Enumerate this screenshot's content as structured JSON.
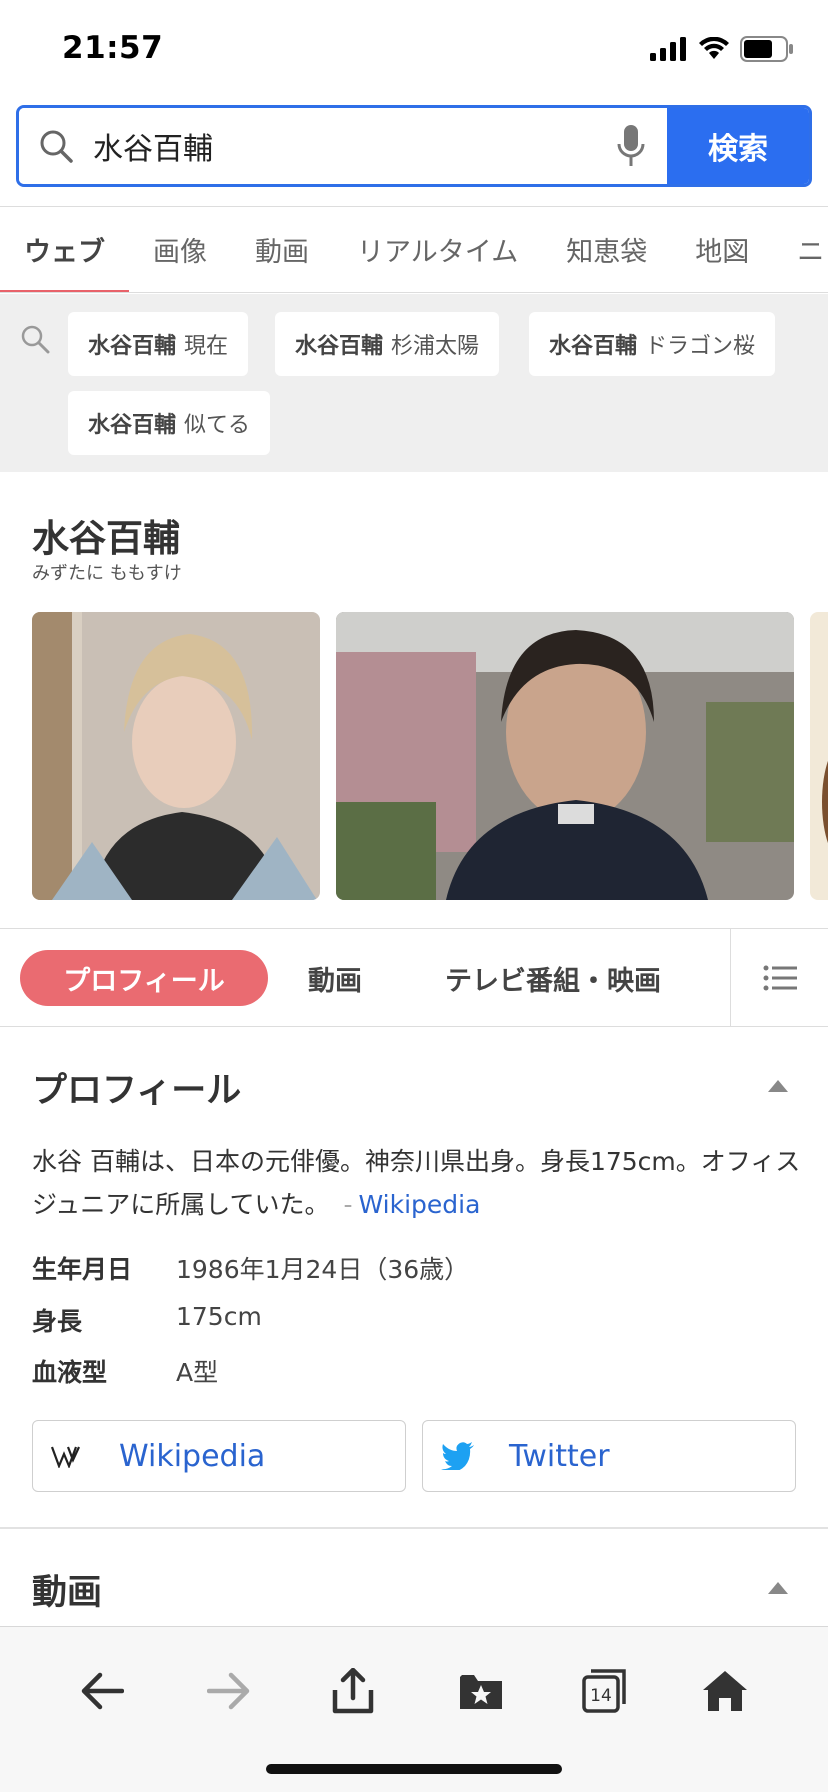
{
  "status": {
    "time": "21:57"
  },
  "search": {
    "query": "水谷百輔",
    "button": "検索"
  },
  "tabs": [
    "ウェブ",
    "画像",
    "動画",
    "リアルタイム",
    "知恵袋",
    "地図",
    "ニ"
  ],
  "suggestions": [
    {
      "bold": "水谷百輔",
      "rest": "現在"
    },
    {
      "bold": "水谷百輔",
      "rest": "杉浦太陽"
    },
    {
      "bold": "水谷百輔",
      "rest": "ドラゴン桜"
    },
    {
      "bold": "水谷百輔",
      "rest": "似てる"
    }
  ],
  "panel": {
    "name": "水谷百輔",
    "reading": "みずたに ももすけ"
  },
  "subtabs": {
    "profile": "プロフィール",
    "video": "動画",
    "tv": "テレビ番組・映画"
  },
  "profile": {
    "title": "プロフィール",
    "desc": "水谷 百輔は、日本の元俳優。神奈川県出身。身長175cm。オフィスジュニアに所属していた。",
    "source_dash": "-",
    "source": "Wikipedia",
    "rows": [
      {
        "k": "生年月日",
        "v": "1986年1月24日（36歳）"
      },
      {
        "k": "身長",
        "v": "175cm"
      },
      {
        "k": "血液型",
        "v": "A型"
      }
    ],
    "links": {
      "wikipedia": "Wikipedia",
      "twitter": "Twitter"
    }
  },
  "video_section": {
    "title": "動画"
  },
  "toolbar": {
    "tabs_count": "14"
  },
  "colors": {
    "accent_blue": "#2b6ef0",
    "accent_red": "#ea6b71",
    "link": "#2a64cf"
  }
}
